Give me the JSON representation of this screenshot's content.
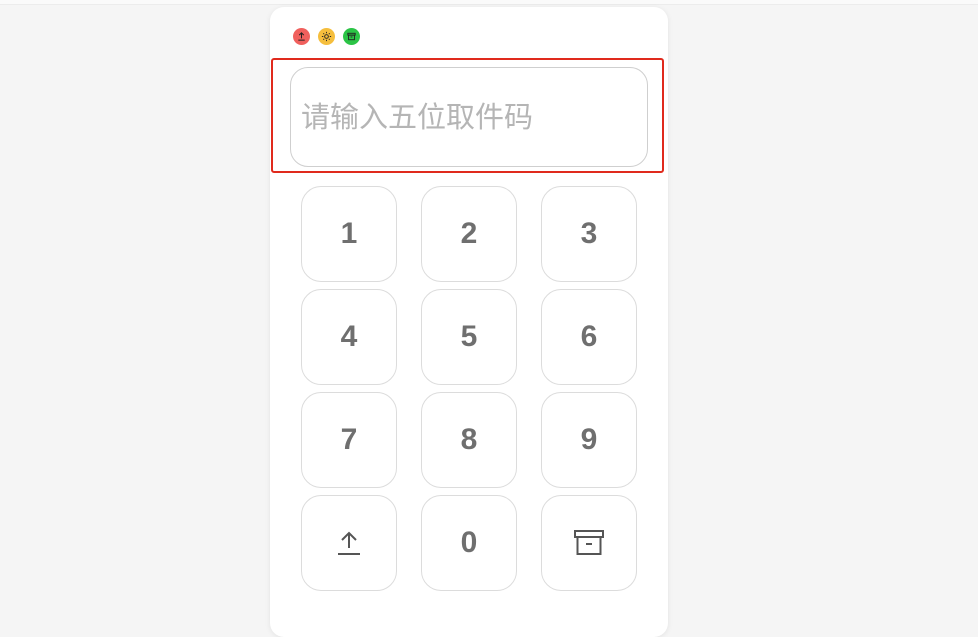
{
  "window": {
    "controls": [
      {
        "name": "upload-icon",
        "color": "#f0605d"
      },
      {
        "name": "sun-icon",
        "color": "#f5be3d"
      },
      {
        "name": "archive-icon",
        "color": "#2bc446"
      }
    ]
  },
  "code_input": {
    "placeholder": "请输入五位取件码",
    "value": ""
  },
  "keypad": {
    "keys": [
      "1",
      "2",
      "3",
      "4",
      "5",
      "6",
      "7",
      "8",
      "9"
    ],
    "zero": "0",
    "left_action_icon": "upload-icon",
    "right_action_icon": "archive-icon"
  },
  "colors": {
    "highlight": "#e02a1d",
    "key_text": "#6f6f6f",
    "placeholder": "#b5b5b5"
  }
}
